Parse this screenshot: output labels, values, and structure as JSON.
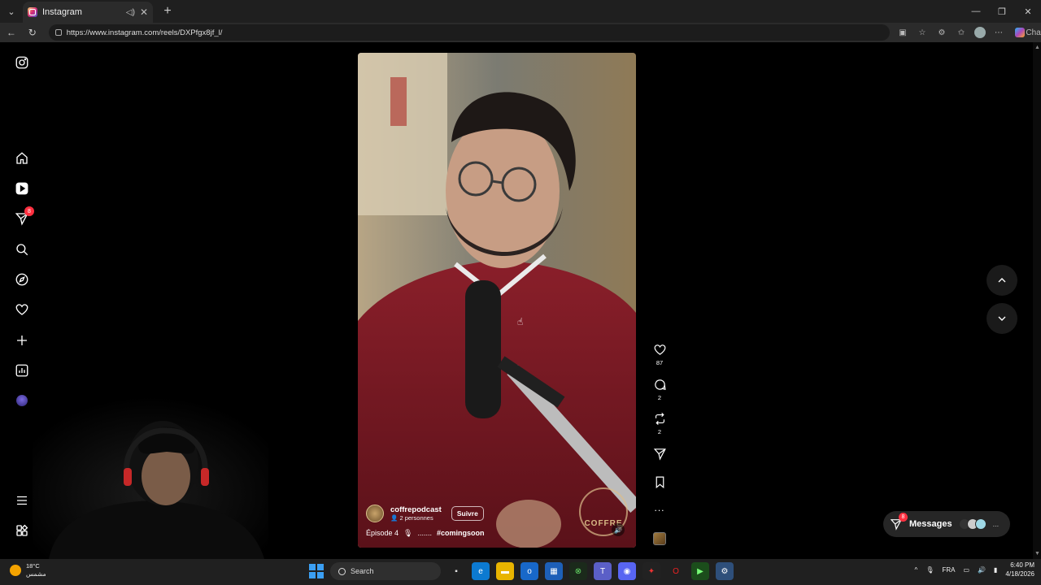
{
  "browser": {
    "tab": {
      "title": "Instagram"
    },
    "new_tab": "+",
    "url": "https://www.instagram.com/reels/DXPfgx8jf_l/",
    "chat_label": "Chat"
  },
  "sidebar": {
    "notifications_badge": "8"
  },
  "reel": {
    "username": "coffrepodcast",
    "collab": "2 personnes",
    "follow_label": "Suivre",
    "caption_prefix": "Épisode 4",
    "caption_dots": ".......",
    "hashtag": "#comingsoon",
    "watermark": "COFFRE"
  },
  "actions": {
    "likes": "87",
    "comments": "2",
    "reposts": "2",
    "more": "..."
  },
  "messages": {
    "label": "Messages",
    "badge": "8",
    "more": "..."
  },
  "taskbar": {
    "temperature": "18°C",
    "weather_desc": "مشمس",
    "search_placeholder": "Search",
    "language": "FRA",
    "time": "6:40 PM",
    "date": "4/18/2026"
  }
}
